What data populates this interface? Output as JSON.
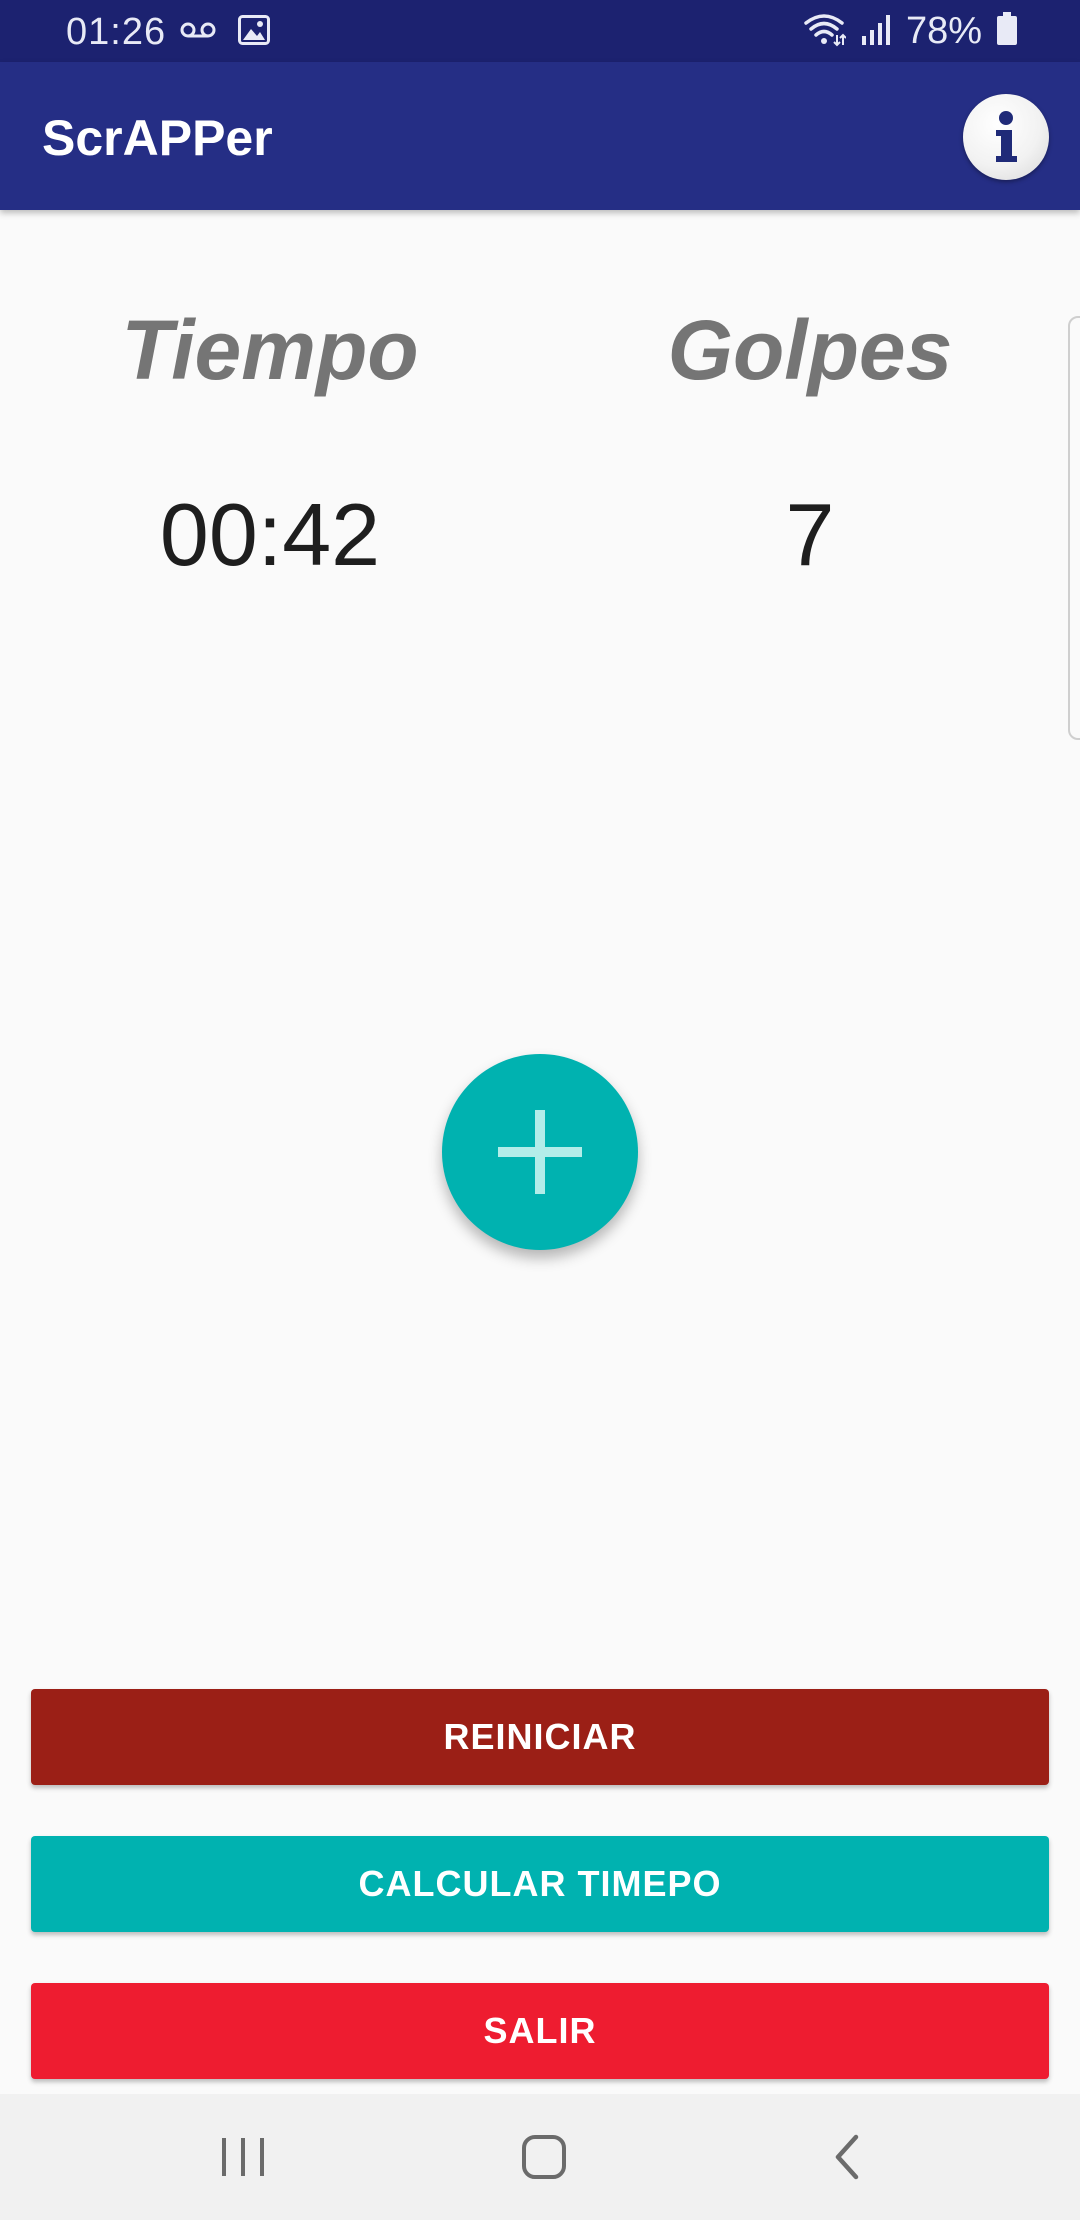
{
  "status_bar": {
    "time": "01:26",
    "battery_percent": "78%",
    "icons": [
      "voicemail-icon",
      "image-icon",
      "wifi-icon",
      "signal-icon",
      "battery-icon"
    ]
  },
  "app_bar": {
    "title": "ScrAPPer",
    "info_icon": "info-icon"
  },
  "stats": {
    "time_label": "Tiempo",
    "time_value": "00:42",
    "hits_label": "Golpes",
    "hits_value": "7"
  },
  "fab": {
    "icon": "plus-icon"
  },
  "buttons": {
    "reset_label": "REINICIAR",
    "calculate_label": "CALCULAR TIMEPO",
    "exit_label": "SALIR"
  },
  "nav_bar": {
    "icons": [
      "recents-icon",
      "home-icon",
      "back-icon"
    ]
  },
  "colors": {
    "status_bar": "#1c2270",
    "app_bar": "#252e85",
    "accent_teal": "#00b2b0",
    "reset_red": "#9b1f16",
    "exit_red": "#ee1c30",
    "label_gray": "#757575"
  }
}
